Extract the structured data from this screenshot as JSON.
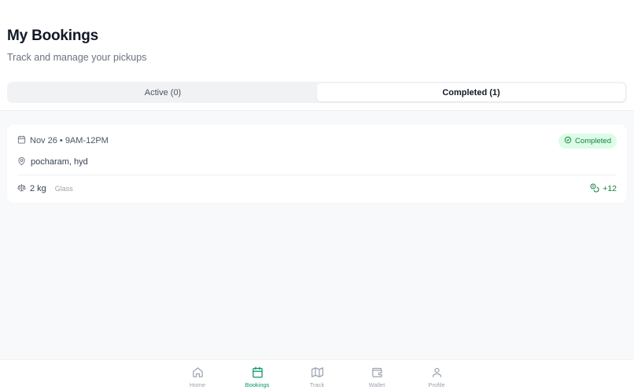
{
  "header": {
    "title": "My Bookings",
    "subtitle": "Track and manage your pickups"
  },
  "tabs": [
    {
      "label": "Active (0)",
      "active": false
    },
    {
      "label": "Completed (1)",
      "active": true
    }
  ],
  "booking": {
    "datetime": "Nov 26 • 9AM-12PM",
    "status": "Completed",
    "address": "pocharam, hyd",
    "weight": "2 kg",
    "material": "Glass",
    "points": "+12"
  },
  "nav": {
    "items": [
      {
        "label": "Home",
        "icon": "home-icon"
      },
      {
        "label": "Bookings",
        "icon": "calendar-icon",
        "active": true
      },
      {
        "label": "Track",
        "icon": "map-icon"
      },
      {
        "label": "Wallet",
        "icon": "wallet-icon"
      },
      {
        "label": "Profile",
        "icon": "user-icon"
      }
    ]
  },
  "colors": {
    "accent": "#059669",
    "badge_bg": "#dcfce7",
    "badge_text": "#15803d"
  }
}
